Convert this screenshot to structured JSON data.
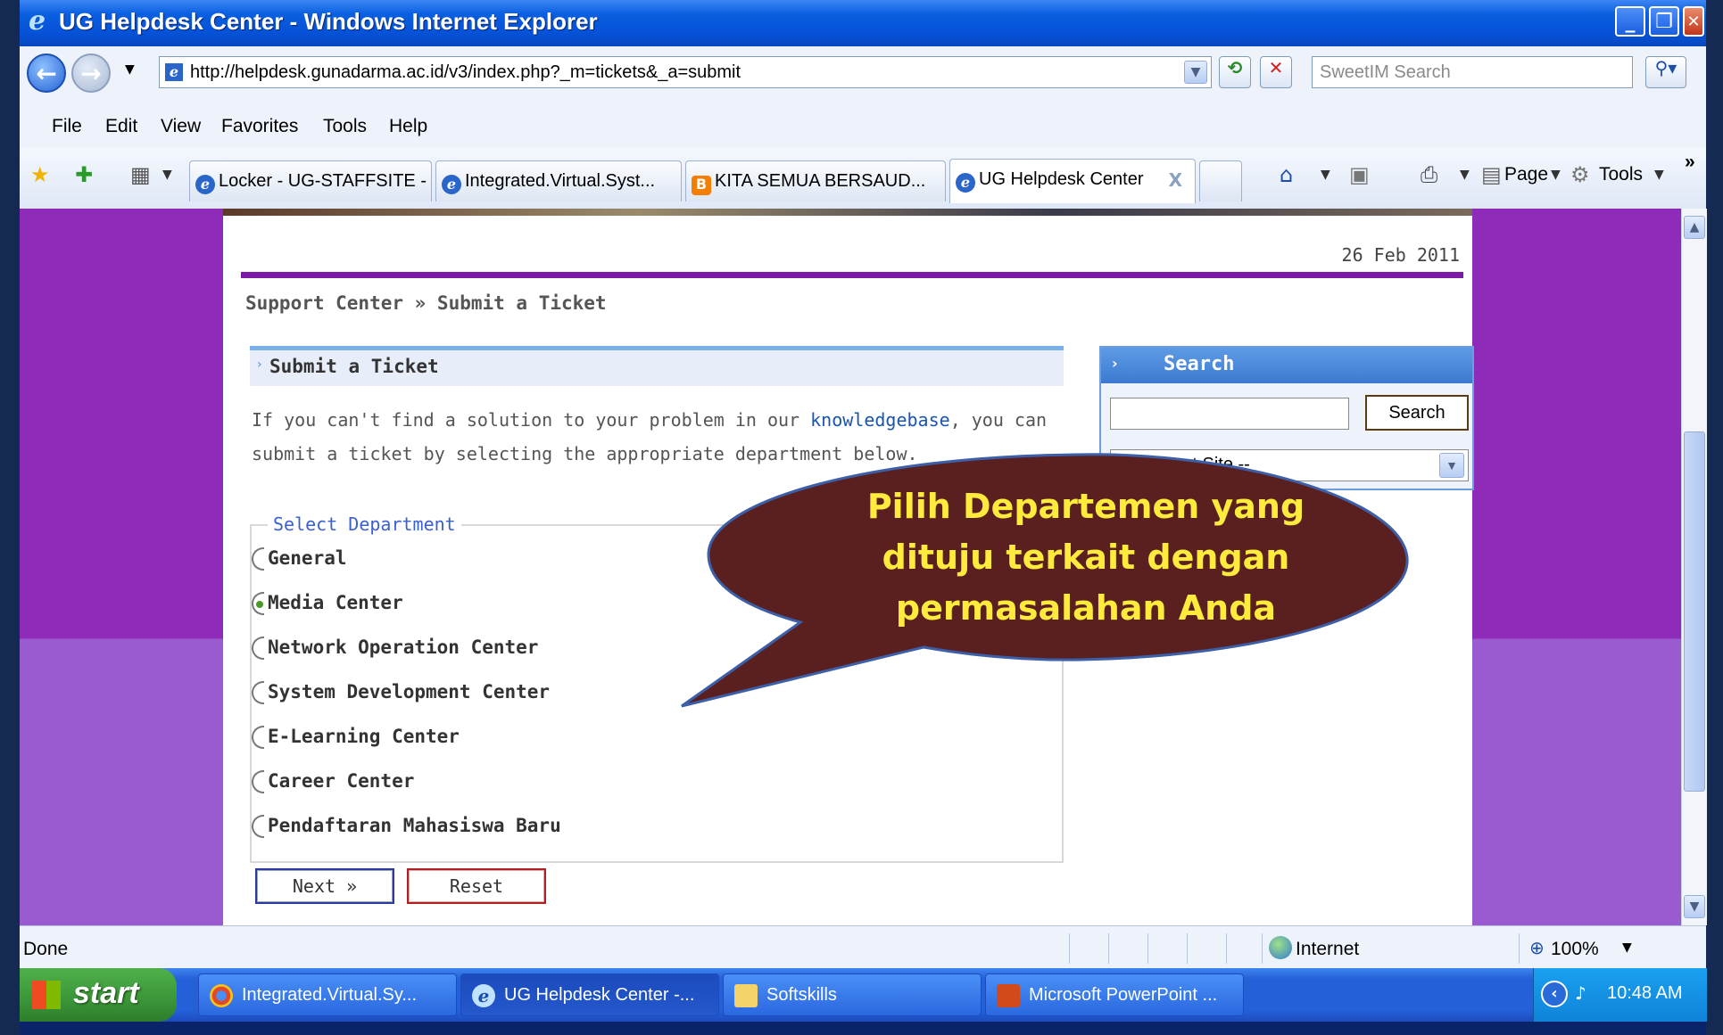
{
  "window": {
    "title": "UG Helpdesk Center - Windows Internet Explorer",
    "minimize": "_",
    "maximize": "❐",
    "close": "✕"
  },
  "address_bar": {
    "url": "http://helpdesk.gunadarma.ac.id/v3/index.php?_m=tickets&_a=submit",
    "search_placeholder": "SweetIM Search",
    "back_icon": "back-arrow-icon",
    "forward_icon": "forward-arrow-icon"
  },
  "menu": [
    "File",
    "Edit",
    "View",
    "Favorites",
    "Tools",
    "Help"
  ],
  "tabs": [
    {
      "label": "Locker - UG-STAFFSITE -",
      "icon": "ie-icon"
    },
    {
      "label": "Integrated.Virtual.Syst...",
      "icon": "ie-icon"
    },
    {
      "label": "KITA SEMUA BERSAUD...",
      "icon": "blogger-icon"
    },
    {
      "label": "UG Helpdesk Center",
      "icon": "ie-icon",
      "active": true
    }
  ],
  "tab_close": "X",
  "command_bar": {
    "page_label": "Page",
    "tools_label": "Tools",
    "more": "»"
  },
  "page": {
    "date": "26 Feb 2011",
    "breadcrumb": "Support Center » Submit a Ticket",
    "section_title": "Submit a Ticket",
    "intro_before": "If you can't find a solution to your problem in our ",
    "intro_link": "knowledgebase",
    "intro_after": ", you can submit a ticket by selecting the appropriate department below.",
    "legend": "Select Department",
    "departments": [
      {
        "label": "General",
        "selected": false
      },
      {
        "label": "Media Center",
        "selected": true
      },
      {
        "label": "Network Operation Center",
        "selected": false
      },
      {
        "label": "System Development Center",
        "selected": false
      },
      {
        "label": "E-Learning Center",
        "selected": false
      },
      {
        "label": "Career Center",
        "selected": false
      },
      {
        "label": "Pendaftaran Mahasiswa Baru",
        "selected": false
      }
    ],
    "next_label": "Next »",
    "reset_label": "Reset"
  },
  "search_panel": {
    "title": "Search",
    "button": "Search",
    "select_value": "-- Support Site --"
  },
  "callout": {
    "lines": [
      "Pilih Departemen yang",
      "dituju terkait dengan",
      "permasalahan Anda"
    ],
    "fill": "#5a1f1f",
    "text_color": "#ffeb3b"
  },
  "status_bar": {
    "status": "Done",
    "zone": "Internet",
    "zoom": "100%"
  },
  "taskbar": {
    "start": "start",
    "tasks": [
      {
        "label": "Integrated.Virtual.Sy...",
        "icon": "chrome-icon"
      },
      {
        "label": "UG Helpdesk Center -...",
        "icon": "ie-icon",
        "active": true
      },
      {
        "label": "Softskills",
        "icon": "folder-icon"
      },
      {
        "label": "Microsoft PowerPoint ...",
        "icon": "powerpoint-icon"
      }
    ],
    "clock": "10:48 AM"
  }
}
